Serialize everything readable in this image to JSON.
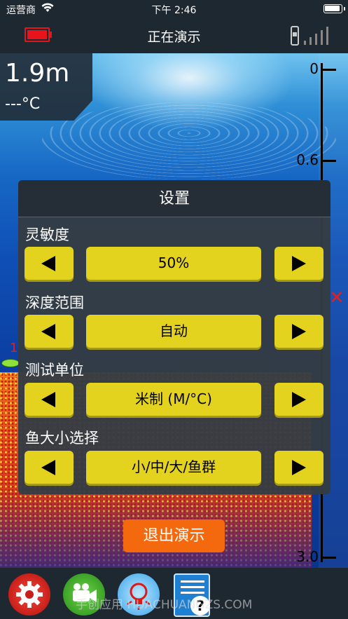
{
  "status_bar": {
    "carrier": "运营商",
    "time": "下午 2:46"
  },
  "nav": {
    "title": "正在演示"
  },
  "sonar": {
    "depth": "1.9m",
    "temperature": "---°C",
    "scale_labels": [
      "0",
      "0.6",
      "3.0"
    ],
    "fish_depth_label": "1"
  },
  "settings": {
    "title": "设置",
    "rows": [
      {
        "label": "灵敏度",
        "value": "50%"
      },
      {
        "label": "深度范围",
        "value": "自动"
      },
      {
        "label": "测试单位",
        "value": "米制 (M/°C)"
      },
      {
        "label": "鱼大小选择",
        "value": "小/中/大/鱼群"
      }
    ]
  },
  "exit_button": "退出演示",
  "toolbar": {
    "watermark": "手创应用 HUACHUANGZS.COM"
  },
  "colors": {
    "button_yellow": "#e3d31f",
    "exit_orange": "#f5690e",
    "battery_red": "#e8141b"
  }
}
